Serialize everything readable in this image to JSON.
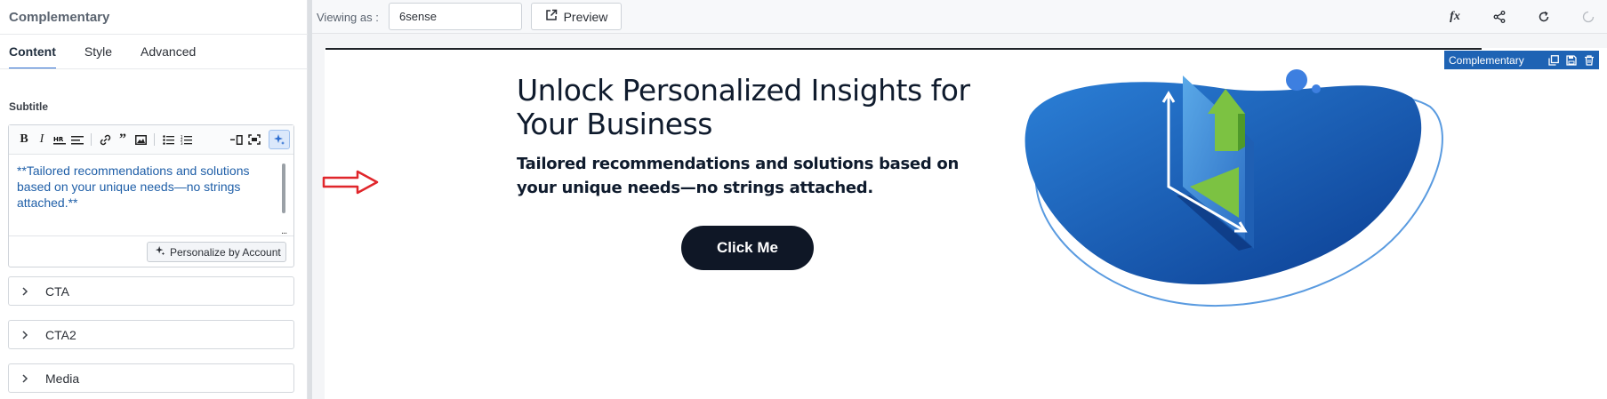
{
  "sidebar": {
    "title": "Complementary",
    "tabs": [
      {
        "label": "Content",
        "active": true
      },
      {
        "label": "Style",
        "active": false
      },
      {
        "label": "Advanced",
        "active": false
      }
    ],
    "subtitle_label": "Subtitle",
    "editor": {
      "text": "**Tailored recommendations and solutions based on your unique needs—no strings attached.**",
      "toolbar_icons": [
        "bold-icon",
        "italic-icon",
        "horizontal-rule-icon",
        "clear-format-icon",
        "link-icon",
        "quote-icon",
        "image-icon",
        "bullet-list-icon",
        "numbered-list-icon",
        "toggle-side-by-side-icon",
        "fullscreen-icon",
        "ai-sparkle-icon"
      ],
      "more_label": "...",
      "personalize_label": "Personalize by Account"
    },
    "accordions": [
      {
        "label": "CTA"
      },
      {
        "label": "CTA2"
      },
      {
        "label": "Media"
      }
    ]
  },
  "topbar": {
    "viewing_label": "Viewing as :",
    "viewing_value": "6sense",
    "preview_label": "Preview",
    "right_icons": [
      "function-icon",
      "share-icon",
      "refresh-icon",
      "loading-icon"
    ]
  },
  "canvas": {
    "block_badge": "Complementary",
    "hero": {
      "title": "Unlock Personalized Insights for Your Business",
      "subtitle": "Tailored recommendations and solutions based on your unique needs—no strings attached.",
      "cta_label": "Click Me"
    }
  },
  "colors": {
    "accent": "#2f6fd1",
    "badge": "#1e63b4",
    "cta_bg": "#0f1726",
    "arrow": "#e0262b",
    "blob_dark": "#0b3d91",
    "blob_light": "#2b7fd6",
    "green": "#7cc242"
  }
}
